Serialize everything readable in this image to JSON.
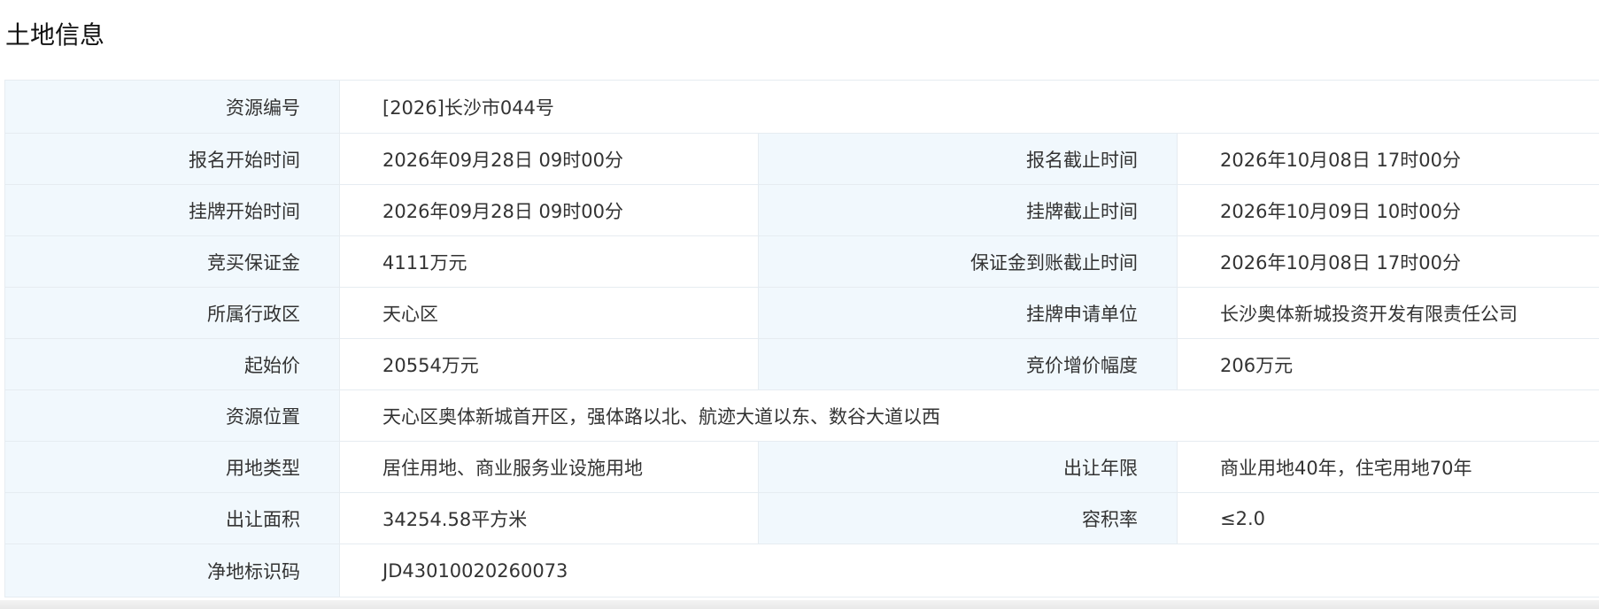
{
  "section": {
    "title": "土地信息"
  },
  "rows": [
    {
      "label": "资源编号",
      "value": "[2026]长沙市044号"
    },
    {
      "label1": "报名开始时间",
      "value1": "2026年09月28日 09时00分",
      "label2": "报名截止时间",
      "value2": "2026年10月08日 17时00分"
    },
    {
      "label1": "挂牌开始时间",
      "value1": "2026年09月28日 09时00分",
      "label2": "挂牌截止时间",
      "value2": "2026年10月09日 10时00分"
    },
    {
      "label1": "竞买保证金",
      "value1": "4111万元",
      "label2": "保证金到账截止时间",
      "value2": "2026年10月08日 17时00分"
    },
    {
      "label1": "所属行政区",
      "value1": "天心区",
      "label2": "挂牌申请单位",
      "value2": "长沙奥体新城投资开发有限责任公司"
    },
    {
      "label1": "起始价",
      "value1": "20554万元",
      "label2": "竞价增价幅度",
      "value2": "206万元"
    },
    {
      "label": "资源位置",
      "value": "天心区奥体新城首开区，强体路以北、航迹大道以东、数谷大道以西"
    },
    {
      "label1": "用地类型",
      "value1": "居住用地、商业服务业设施用地",
      "label2": "出让年限",
      "value2": "商业用地40年，住宅用地70年"
    },
    {
      "label1": "出让面积",
      "value1": "34254.58平方米",
      "label2": "容积率",
      "value2": "≤2.0"
    },
    {
      "label": "净地标识码",
      "value": "JD43010020260073"
    }
  ],
  "colors": {
    "label_bg": "#f1f8fd",
    "border": "#e6ecf1",
    "text": "#333333"
  }
}
